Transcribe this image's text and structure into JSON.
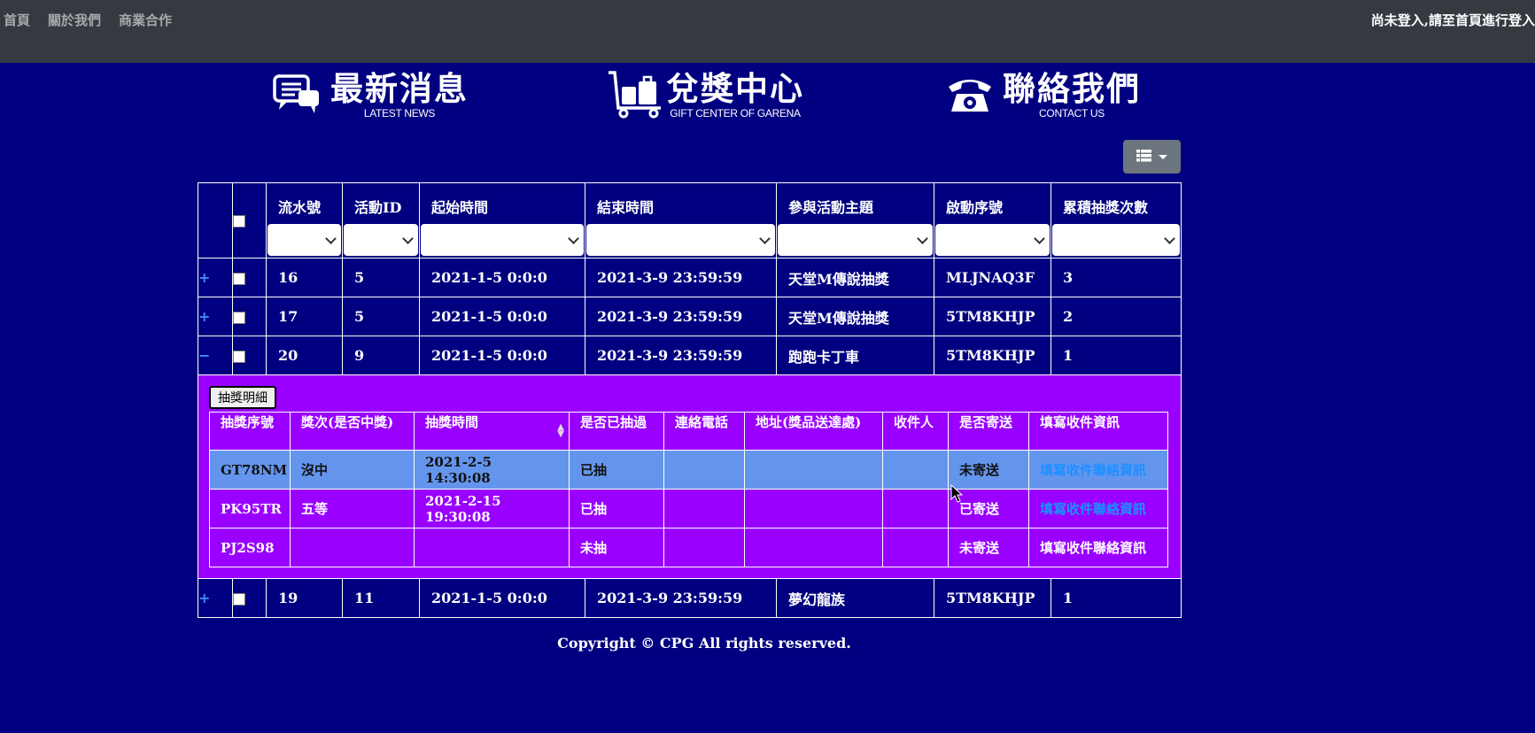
{
  "nav": {
    "home": "首頁",
    "about": "關於我們",
    "business": "商業合作",
    "login_msg": "尚未登入,請至首頁進行登入"
  },
  "banners": [
    {
      "title": "最新消息",
      "subtitle": "LATEST NEWS",
      "icon": "chat-bubble-icon"
    },
    {
      "title": "兌獎中心",
      "subtitle": "GIFT CENTER OF GARENA",
      "icon": "luggage-cart-icon"
    },
    {
      "title": "聯絡我們",
      "subtitle": "CONTACT US",
      "icon": "telephone-icon"
    }
  ],
  "columns_toggle": {
    "icon": "list-icon"
  },
  "table": {
    "headers": [
      "流水號",
      "活動ID",
      "起始時間",
      "結束時間",
      "參與活動主題",
      "啟動序號",
      "累積抽獎次數"
    ],
    "rows": [
      {
        "expander": "+",
        "cells": [
          "16",
          "5",
          "2021-1-5 0:0:0",
          "2021-3-9 23:59:59",
          "天堂M傳說抽獎",
          "MLJNAQ3F",
          "3"
        ]
      },
      {
        "expander": "+",
        "cells": [
          "17",
          "5",
          "2021-1-5 0:0:0",
          "2021-3-9 23:59:59",
          "天堂M傳說抽獎",
          "5TM8KHJP",
          "2"
        ]
      },
      {
        "expander": "−",
        "cells": [
          "20",
          "9",
          "2021-1-5 0:0:0",
          "2021-3-9 23:59:59",
          "跑跑卡丁車",
          "5TM8KHJP",
          "1"
        ]
      },
      {
        "expander": "+",
        "cells": [
          "19",
          "11",
          "2021-1-5 0:0:0",
          "2021-3-9 23:59:59",
          "夢幻龍族",
          "5TM8KHJP",
          "1"
        ]
      }
    ]
  },
  "detail": {
    "button": "抽獎明細",
    "headers": [
      "抽獎序號",
      "獎次(是否中獎)",
      "抽獎時間",
      "是否已抽過",
      "連絡電話",
      "地址(獎品送達處)",
      "收件人",
      "是否寄送",
      "填寫收件資訊"
    ],
    "rows": [
      [
        "GT78NM",
        "沒中",
        "2021-2-5 14:30:08",
        "已抽",
        "",
        "",
        "",
        "未寄送",
        "填寫收件聯絡資訊"
      ],
      [
        "PK95TR",
        "五等",
        "2021-2-15 19:30:08",
        "已抽",
        "",
        "",
        "",
        "已寄送",
        "填寫收件聯絡資訊"
      ],
      [
        "PJ2S98",
        "",
        "",
        "未抽",
        "",
        "",
        "",
        "未寄送",
        "填寫收件聯絡資訊"
      ]
    ]
  },
  "footer": "Copyright © CPG All rights reserved."
}
